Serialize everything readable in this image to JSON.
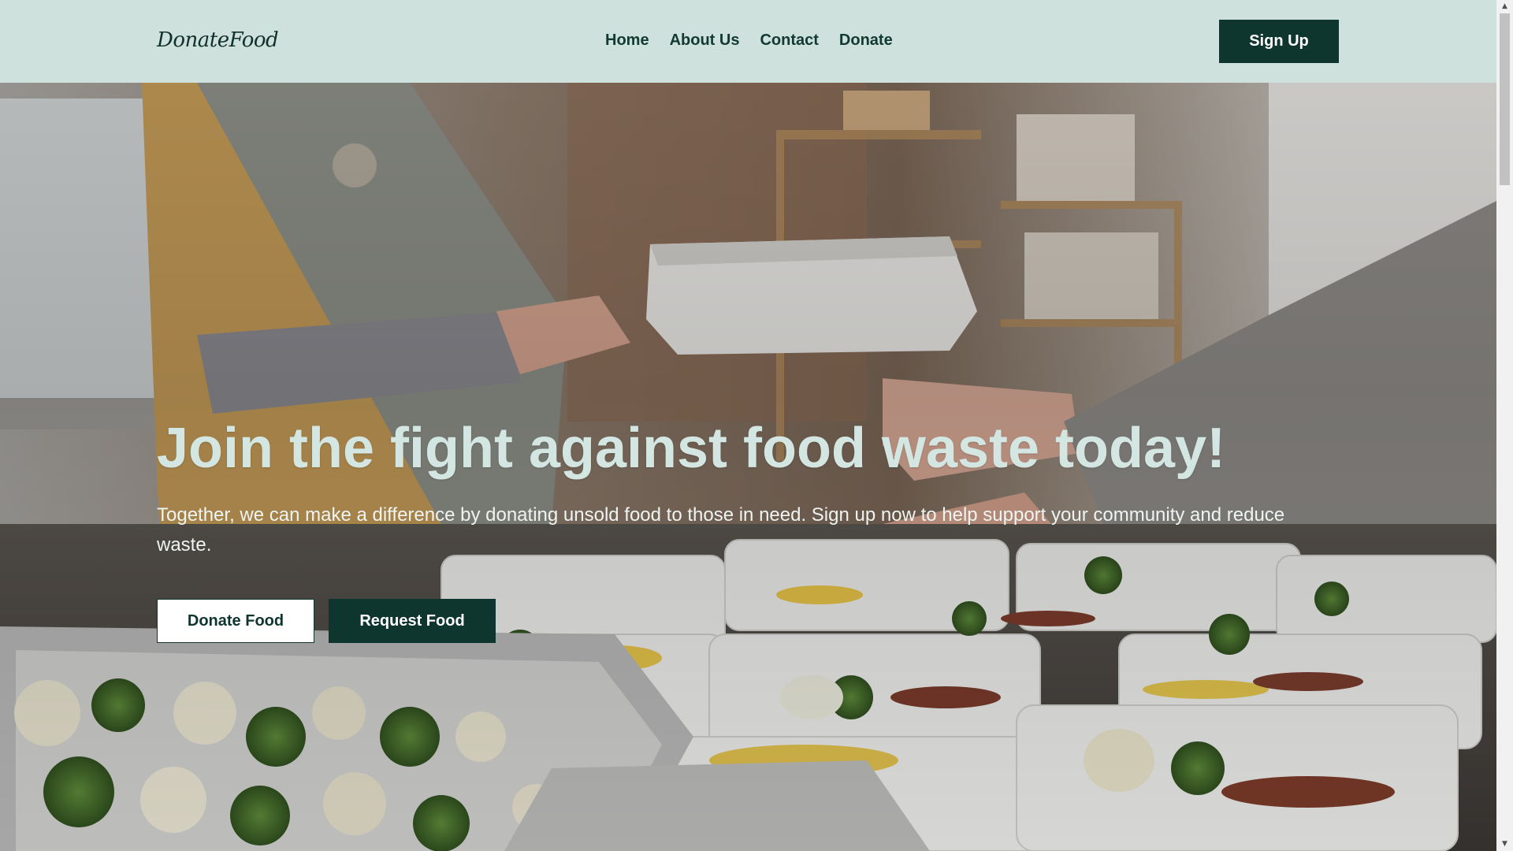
{
  "navbar": {
    "logo": "DonateFood",
    "links": [
      "Home",
      "About Us",
      "Contact",
      "Donate"
    ],
    "signup_label": "Sign Up",
    "background_color": "#cfe1dd",
    "accent_color": "#0f352f"
  },
  "hero": {
    "title": "Join the fight against food waste today!",
    "subtitle": "Together, we can make a difference by donating unsold food to those in need. Sign up now to help support your community and reduce waste.",
    "donate_button": "Donate Food",
    "request_button": "Request Food",
    "title_color": "#d3e6e2"
  },
  "icons": {
    "scroll_up": "triangle-up-icon",
    "scroll_down": "triangle-down-icon"
  }
}
